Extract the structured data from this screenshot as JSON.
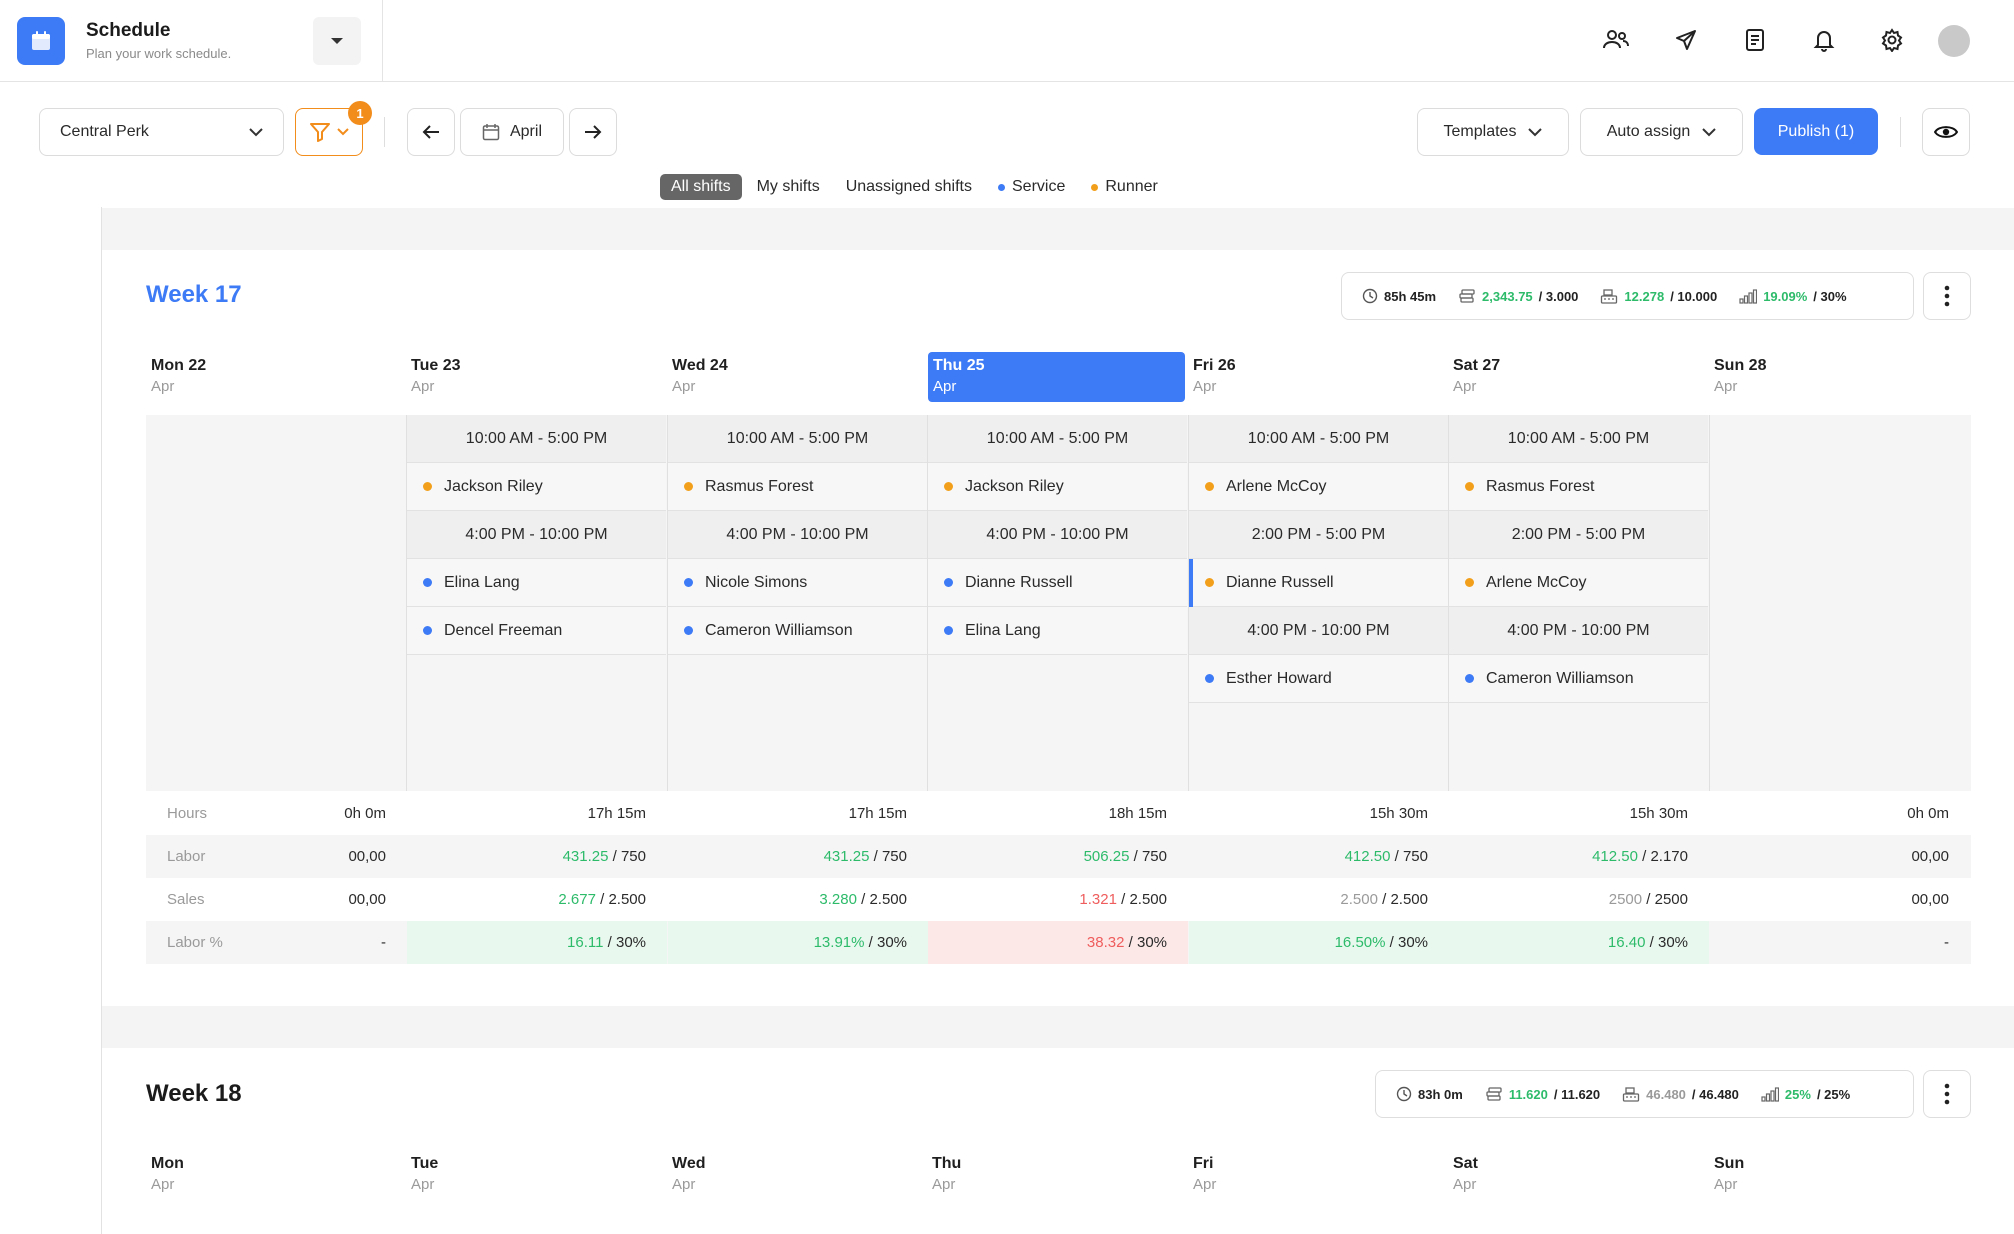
{
  "header": {
    "title": "Schedule",
    "subtitle": "Plan your work schedule.",
    "icons": [
      "users-icon",
      "send-icon",
      "document-icon",
      "bell-icon",
      "settings-icon"
    ]
  },
  "toolbar": {
    "location": "Central Perk",
    "filter_count": "1",
    "month": "April",
    "templates": "Templates",
    "auto_assign": "Auto assign",
    "publish": "Publish (1)"
  },
  "tabs": [
    {
      "label": "All shifts",
      "active": true
    },
    {
      "label": "My shifts"
    },
    {
      "label": "Unassigned shifts"
    },
    {
      "label": "Service",
      "dot": "#3d7af5"
    },
    {
      "label": "Runner",
      "dot": "#f2a01b"
    }
  ],
  "colors": {
    "accent": "#3d7af5",
    "service": "#3d7af5",
    "runner": "#f2a01b",
    "filter": "#f28c1b",
    "good": "#2dbb6a",
    "bad": "#ef5d5d"
  },
  "week17": {
    "title": "Week 17",
    "stats": {
      "hours": "85h 45m",
      "labor_value": "2,343.75",
      "labor_target": "/ 3.000",
      "sales_value": "12.278",
      "sales_target": "/ 10.000",
      "pct_value": "19.09%",
      "pct_target": "/ 30%"
    },
    "days": [
      {
        "name": "Mon 22",
        "month": "Apr"
      },
      {
        "name": "Tue 23",
        "month": "Apr"
      },
      {
        "name": "Wed 24",
        "month": "Apr"
      },
      {
        "name": "Thu 25",
        "month": "Apr",
        "today": true
      },
      {
        "name": "Fri 26",
        "month": "Apr"
      },
      {
        "name": "Sat 27",
        "month": "Apr"
      },
      {
        "name": "Sun 28",
        "month": "Apr"
      }
    ],
    "shifts": [
      [],
      [
        {
          "time": "10:00 AM - 5:00 PM",
          "staff": [
            {
              "name": "Jackson Riley",
              "role": "runner"
            }
          ]
        },
        {
          "time": "4:00 PM - 10:00 PM",
          "staff": [
            {
              "name": "Elina Lang",
              "role": "service"
            },
            {
              "name": "Dencel Freeman",
              "role": "service"
            }
          ]
        }
      ],
      [
        {
          "time": "10:00 AM - 5:00 PM",
          "staff": [
            {
              "name": "Rasmus Forest",
              "role": "runner"
            }
          ]
        },
        {
          "time": "4:00 PM - 10:00 PM",
          "staff": [
            {
              "name": "Nicole Simons",
              "role": "service"
            },
            {
              "name": "Cameron Williamson",
              "role": "service"
            }
          ]
        }
      ],
      [
        {
          "time": "10:00 AM - 5:00 PM",
          "staff": [
            {
              "name": "Jackson Riley",
              "role": "runner"
            }
          ]
        },
        {
          "time": "4:00 PM - 10:00 PM",
          "staff": [
            {
              "name": "Dianne Russell",
              "role": "service"
            },
            {
              "name": "Elina Lang",
              "role": "service"
            }
          ]
        }
      ],
      [
        {
          "time": "10:00 AM - 5:00 PM",
          "staff": [
            {
              "name": "Arlene McCoy",
              "role": "runner"
            }
          ]
        },
        {
          "time": "2:00 PM - 5:00 PM",
          "staff": [
            {
              "name": "Dianne Russell",
              "role": "runner",
              "selected": true
            }
          ]
        },
        {
          "time": "4:00 PM - 10:00 PM",
          "staff": [
            {
              "name": "Esther Howard",
              "role": "service"
            }
          ]
        }
      ],
      [
        {
          "time": "10:00 AM - 5:00 PM",
          "staff": [
            {
              "name": "Rasmus Forest",
              "role": "runner"
            }
          ]
        },
        {
          "time": "2:00 PM - 5:00 PM",
          "staff": [
            {
              "name": "Arlene McCoy",
              "role": "runner"
            }
          ]
        },
        {
          "time": "4:00 PM - 10:00 PM",
          "staff": [
            {
              "name": "Cameron Williamson",
              "role": "service"
            }
          ]
        }
      ],
      []
    ],
    "summary": {
      "labels": [
        "Hours",
        "Labor",
        "Sales",
        "Labor %"
      ],
      "hours": [
        "0h 0m",
        "17h 15m",
        "17h 15m",
        "18h 15m",
        "15h 30m",
        "15h 30m",
        "0h 0m"
      ],
      "labor": [
        {
          "value": "00,00"
        },
        {
          "value": "431.25",
          "target": "/ 750",
          "tone": "green"
        },
        {
          "value": "431.25",
          "target": "/ 750",
          "tone": "green"
        },
        {
          "value": "506.25",
          "target": "/ 750",
          "tone": "green"
        },
        {
          "value": "412.50",
          "target": "/ 750",
          "tone": "green"
        },
        {
          "value": "412.50",
          "target": "/ 2.170",
          "tone": "green"
        },
        {
          "value": "00,00"
        }
      ],
      "sales": [
        {
          "value": "00,00"
        },
        {
          "value": "2.677",
          "target": "/ 2.500",
          "tone": "green"
        },
        {
          "value": "3.280",
          "target": "/ 2.500",
          "tone": "green"
        },
        {
          "value": "1.321",
          "target": "/ 2.500",
          "tone": "red"
        },
        {
          "value": "2.500",
          "target": "/ 2.500",
          "tone": "grey"
        },
        {
          "value": "2500",
          "target": "/ 2500",
          "tone": "grey"
        },
        {
          "value": "00,00"
        }
      ],
      "labor_pct": [
        {
          "value": "-"
        },
        {
          "value": "16.11",
          "target": "/ 30%",
          "tone": "green"
        },
        {
          "value": "13.91%",
          "target": "/ 30%",
          "tone": "green"
        },
        {
          "value": "38.32",
          "target": "/ 30%",
          "tone": "red"
        },
        {
          "value": "16.50%",
          "target": "/ 30%",
          "tone": "green"
        },
        {
          "value": "16.40",
          "target": "/ 30%",
          "tone": "green"
        },
        {
          "value": "-"
        }
      ]
    }
  },
  "week18": {
    "title": "Week 18",
    "stats": {
      "hours": "83h 0m",
      "labor_value": "11.620",
      "labor_target": "/ 11.620",
      "sales_value": "46.480",
      "sales_target": "/ 46.480",
      "pct_value": "25%",
      "pct_target": "/ 25%"
    },
    "days": [
      {
        "name": "Mon",
        "month": "Apr"
      },
      {
        "name": "Tue",
        "month": "Apr"
      },
      {
        "name": "Wed",
        "month": "Apr"
      },
      {
        "name": "Thu",
        "month": "Apr"
      },
      {
        "name": "Fri",
        "month": "Apr"
      },
      {
        "name": "Sat",
        "month": "Apr"
      },
      {
        "name": "Sun",
        "month": "Apr"
      }
    ]
  }
}
